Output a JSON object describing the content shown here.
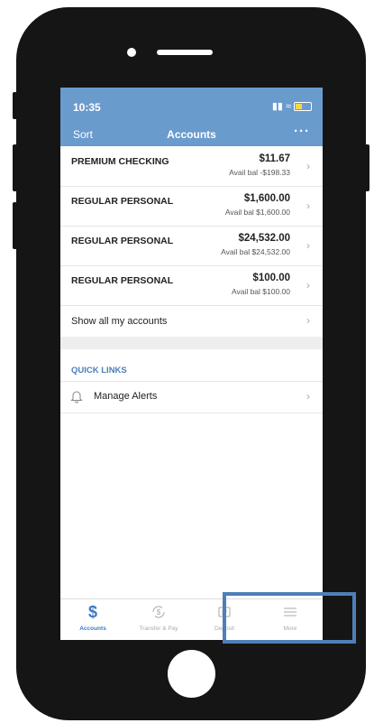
{
  "status_bar": {
    "time": "10:35"
  },
  "nav": {
    "left": "Sort",
    "title": "Accounts",
    "right": "···"
  },
  "accounts": [
    {
      "name": "PREMIUM CHECKING",
      "balance": "$11.67",
      "avail": "Avail bal -$198.33"
    },
    {
      "name": "REGULAR PERSONAL",
      "balance": "$1,600.00",
      "avail": "Avail bal $1,600.00"
    },
    {
      "name": "REGULAR PERSONAL",
      "balance": "$24,532.00",
      "avail": "Avail bal $24,532.00"
    },
    {
      "name": "REGULAR PERSONAL",
      "balance": "$100.00",
      "avail": "Avail bal $100.00"
    }
  ],
  "show_all": "Show all my accounts",
  "quick_links": {
    "header": "QUICK LINKS",
    "items": [
      {
        "label": "Manage Alerts",
        "icon": "bell-icon"
      }
    ]
  },
  "tabs": [
    {
      "label": "Accounts",
      "icon": "dollar-icon",
      "active": true
    },
    {
      "label": "Transfer & Pay",
      "icon": "transfer-icon",
      "active": false
    },
    {
      "label": "Deposit",
      "icon": "deposit-icon",
      "active": false
    },
    {
      "label": "More",
      "icon": "menu-icon",
      "active": false
    }
  ],
  "colors": {
    "header": "#6a9bcd",
    "accent": "#3d78c4",
    "highlight_box": "#4e7fb7"
  }
}
